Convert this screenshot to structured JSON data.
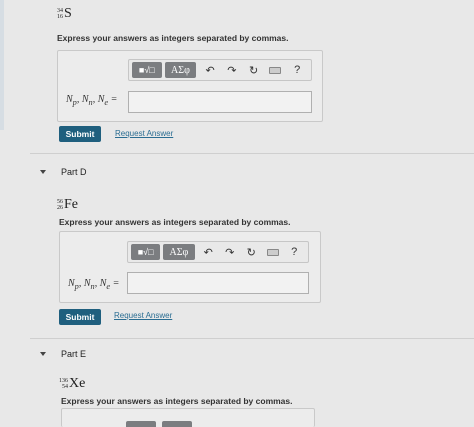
{
  "partC": {
    "iso_mass": "34",
    "iso_atomic": "16",
    "iso_symbol": "S",
    "instruction": "Express your answers as integers separated by commas.",
    "toolbar": {
      "frac": "■√□",
      "greek": "ΑΣφ",
      "undo": "↶",
      "redo": "↷",
      "reset": "↻",
      "help": "?"
    },
    "label_html": "Np, Nn, Ne =",
    "submit": "Submit",
    "request": "Request Answer"
  },
  "partD": {
    "title": "Part D",
    "iso_mass": "56",
    "iso_atomic": "26",
    "iso_symbol": "Fe",
    "instruction": "Express your answers as integers separated by commas.",
    "toolbar": {
      "frac": "■√□",
      "greek": "ΑΣφ",
      "undo": "↶",
      "redo": "↷",
      "reset": "↻",
      "help": "?"
    },
    "submit": "Submit",
    "request": "Request Answer"
  },
  "partE": {
    "title": "Part E",
    "iso_mass": "136",
    "iso_atomic": "54",
    "iso_symbol": "Xe",
    "instruction": "Express your answers as integers separated by commas."
  },
  "colors": {
    "submit": "#1f5f7e",
    "link": "#2a6d92"
  }
}
